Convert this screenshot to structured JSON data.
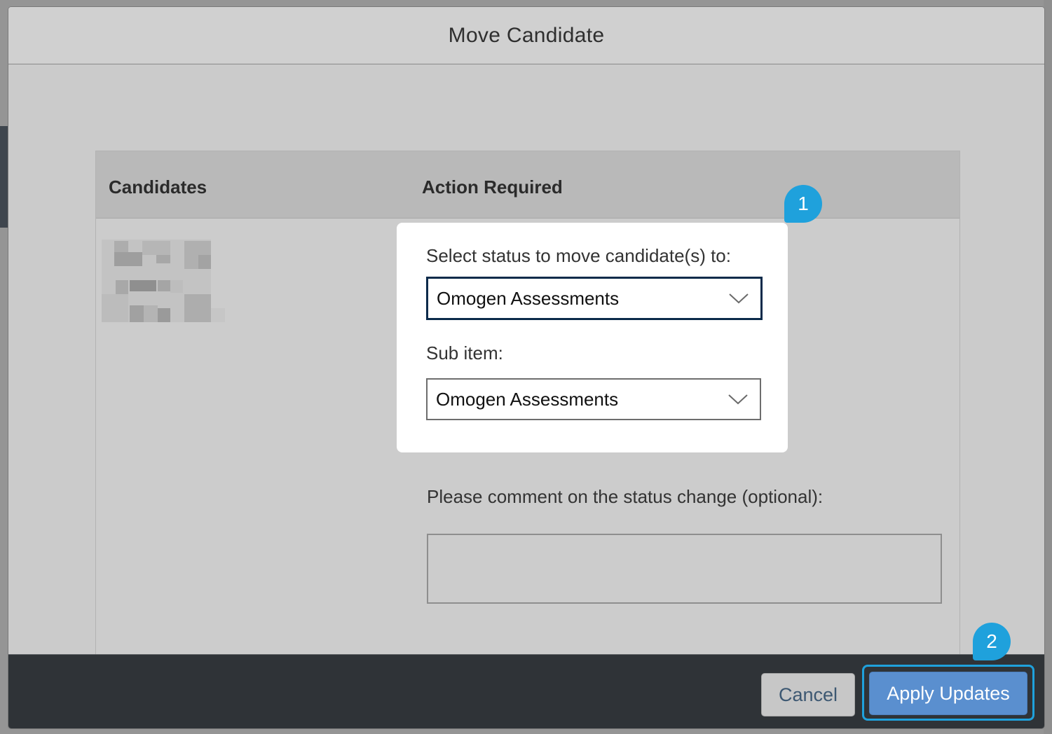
{
  "dialog": {
    "title": "Move Candidate"
  },
  "table": {
    "headers": [
      "Candidates",
      "Action Required"
    ]
  },
  "status_field": {
    "label": "Select status to move candidate(s) to:",
    "value": "Omogen Assessments"
  },
  "sub_item_field": {
    "label": "Sub item:",
    "value": "Omogen Assessments"
  },
  "comment_field": {
    "label": "Please comment on the status change (optional):",
    "value": ""
  },
  "callouts": [
    "1",
    "2"
  ],
  "footer": {
    "cancel_label": "Cancel",
    "apply_label": "Apply Updates"
  },
  "colors": {
    "callout": "#1fa1dc",
    "apply_button": "#5a8fcf",
    "footer_bg": "#2f3337"
  }
}
